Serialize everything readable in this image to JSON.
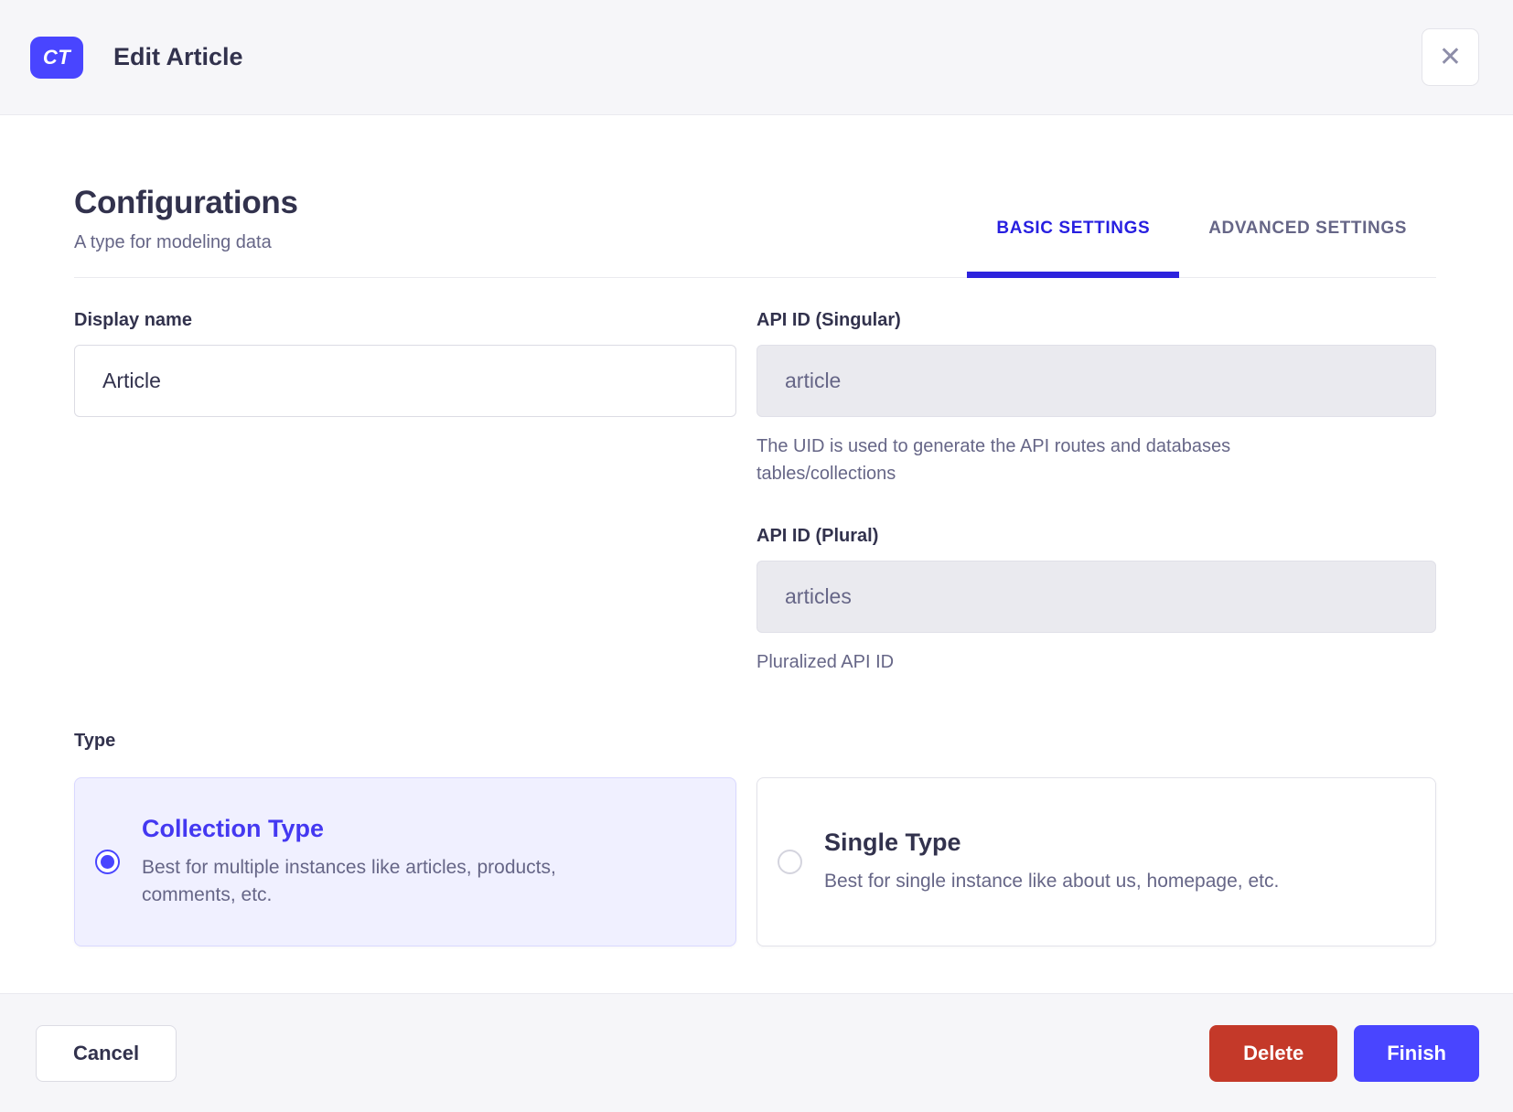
{
  "header": {
    "badge_label": "CT",
    "title": "Edit Article",
    "close_icon": "✕"
  },
  "configurations": {
    "title": "Configurations",
    "subtitle": "A type for modeling data"
  },
  "tabs": [
    {
      "label": "BASIC SETTINGS",
      "active": true
    },
    {
      "label": "ADVANCED SETTINGS",
      "active": false
    }
  ],
  "form": {
    "display_name": {
      "label": "Display name",
      "value": "Article"
    },
    "api_id_singular": {
      "label": "API ID (Singular)",
      "value": "article",
      "helper": "The UID is used to generate the API routes and databases tables/collections"
    },
    "api_id_plural": {
      "label": "API ID (Plural)",
      "value": "articles",
      "helper": "Pluralized API ID"
    },
    "type": {
      "label": "Type",
      "options": [
        {
          "title": "Collection Type",
          "description": "Best for multiple instances like articles, products, comments, etc.",
          "selected": true
        },
        {
          "title": "Single Type",
          "description": "Best for single instance like about us, homepage, etc.",
          "selected": false
        }
      ]
    }
  },
  "footer": {
    "cancel_label": "Cancel",
    "delete_label": "Delete",
    "finish_label": "Finish"
  },
  "colors": {
    "primary": "#4945ff",
    "tab_active": "#271fe0",
    "danger": "#c43929",
    "selected_card_bg": "#f0f0ff",
    "text_dark": "#32324d",
    "text_muted": "#666687",
    "header_bg": "#f6f6f9"
  }
}
